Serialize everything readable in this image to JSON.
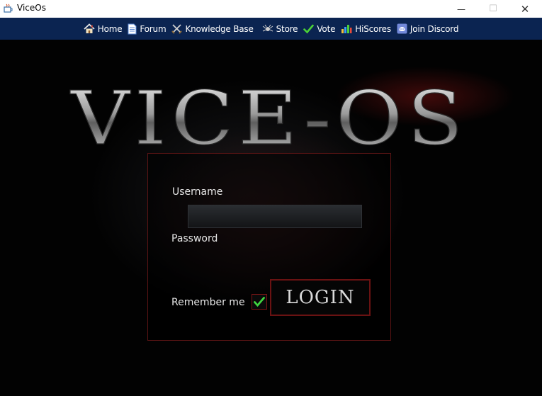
{
  "window": {
    "title": "ViceOs",
    "minimize_glyph": "—",
    "maximize_glyph": "☐",
    "close_glyph": "✕"
  },
  "nav": {
    "items": [
      {
        "label": "Home",
        "icon": "home-icon"
      },
      {
        "label": "Forum",
        "icon": "document-icon"
      },
      {
        "label": "Knowledge Base",
        "icon": "crossed-swords-icon"
      },
      {
        "label": "Store",
        "icon": "spider-icon"
      },
      {
        "label": "Vote",
        "icon": "checkmark-icon"
      },
      {
        "label": "HiScores",
        "icon": "bar-chart-icon"
      },
      {
        "label": "Join Discord",
        "icon": "discord-icon"
      }
    ]
  },
  "logo": {
    "text": "VICE-OS"
  },
  "login": {
    "username_label": "Username",
    "username_value": "",
    "password_label": "Password",
    "remember_label": "Remember me",
    "remember_checked": true,
    "login_button": "LOGIN"
  },
  "colors": {
    "navbar": "#0b2451",
    "panel_border": "#5a1414",
    "check": "#3fd43f"
  }
}
